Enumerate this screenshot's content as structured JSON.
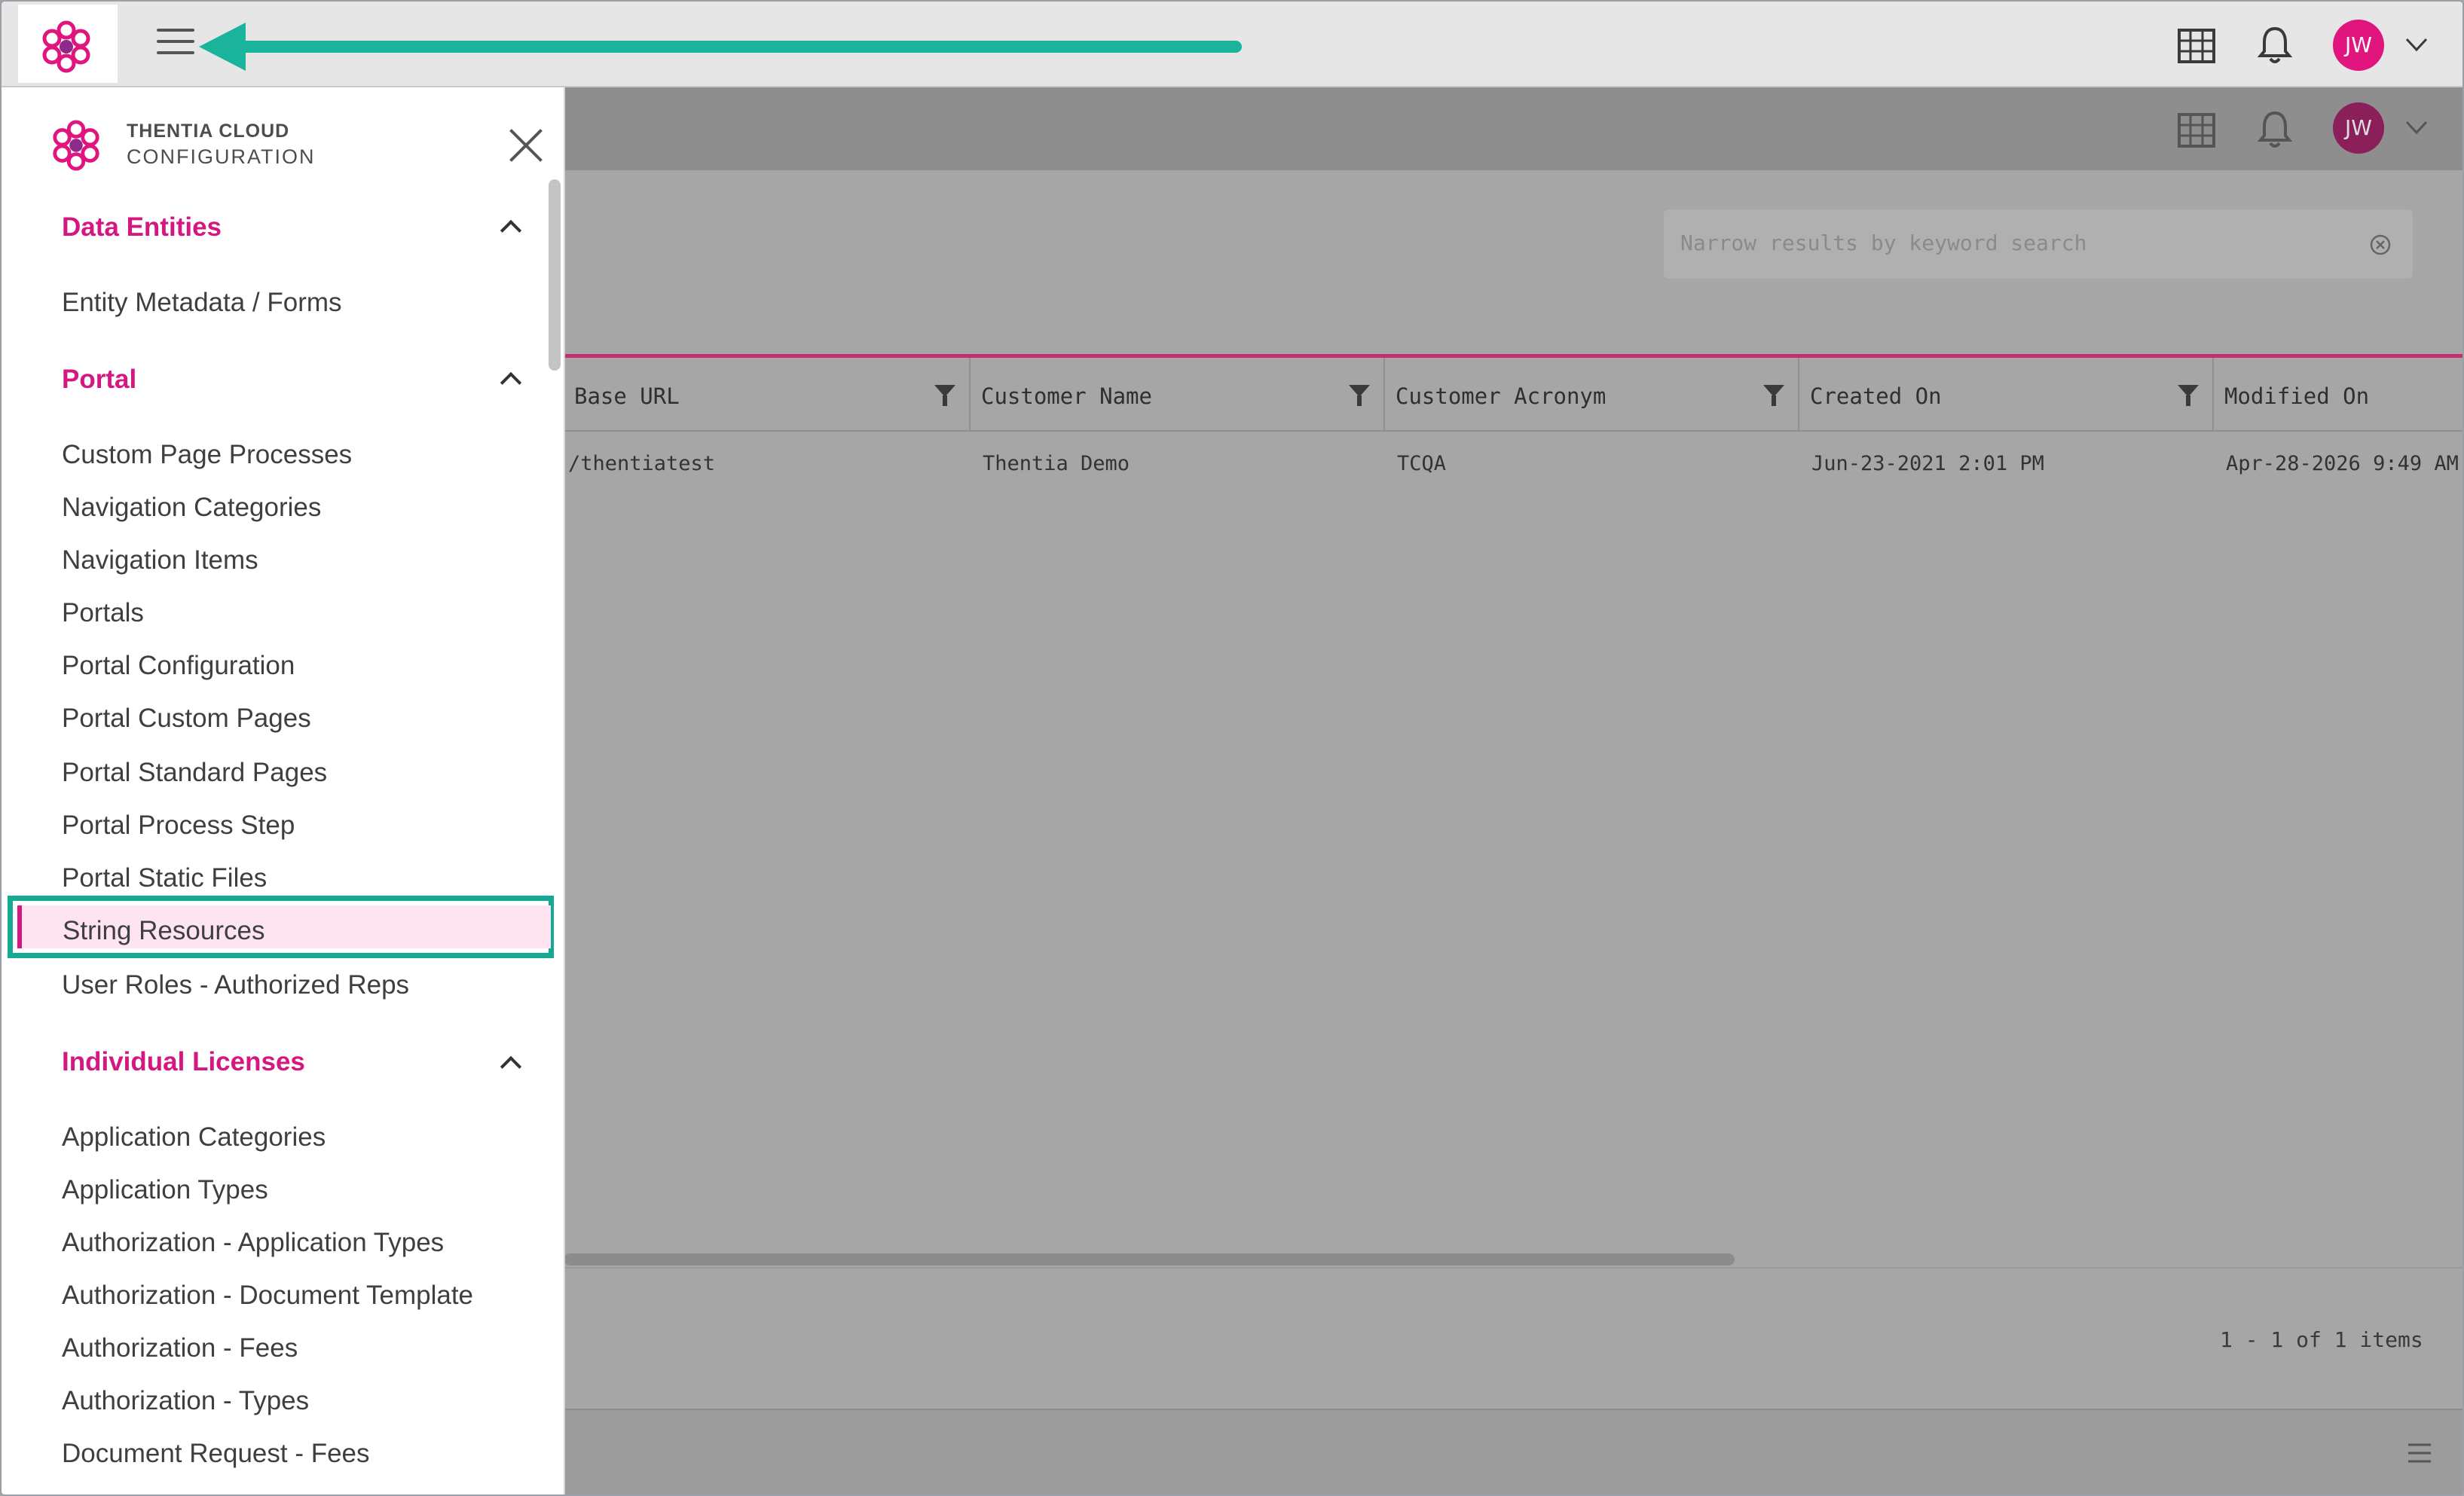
{
  "brand": {
    "line1": "THENTIA CLOUD",
    "line2": "CONFIGURATION"
  },
  "user": {
    "initials": "JW"
  },
  "search": {
    "placeholder": "Narrow results by keyword search"
  },
  "table": {
    "columns": [
      "Base URL",
      "Customer Name",
      "Customer Acronym",
      "Created On",
      "Modified On"
    ],
    "rows": [
      [
        "/thentiatest",
        "Thentia Demo",
        "TCQA",
        "Jun-23-2021 2:01 PM",
        "Apr-28-2026 9:49 AM"
      ]
    ],
    "pager": "1 - 1 of 1 items"
  },
  "menu": {
    "sections": [
      {
        "label": "Data Entities",
        "items": [
          "Entity Metadata / Forms"
        ]
      },
      {
        "label": "Portal",
        "items": [
          "Custom Page Processes",
          "Navigation Categories",
          "Navigation Items",
          "Portals",
          "Portal Configuration",
          "Portal Custom Pages",
          "Portal Standard Pages",
          "Portal Process Step",
          "Portal Static Files",
          "String Resources",
          "User Roles - Authorized Reps"
        ]
      },
      {
        "label": "Individual Licenses",
        "items": [
          "Application Categories",
          "Application Types",
          "Authorization - Application Types",
          "Authorization - Document Template",
          "Authorization - Fees",
          "Authorization - Types",
          "Document Request - Fees"
        ]
      }
    ],
    "selected": "String Resources"
  },
  "colors": {
    "accent": "#d41781",
    "annotation": "#1ab39b"
  }
}
